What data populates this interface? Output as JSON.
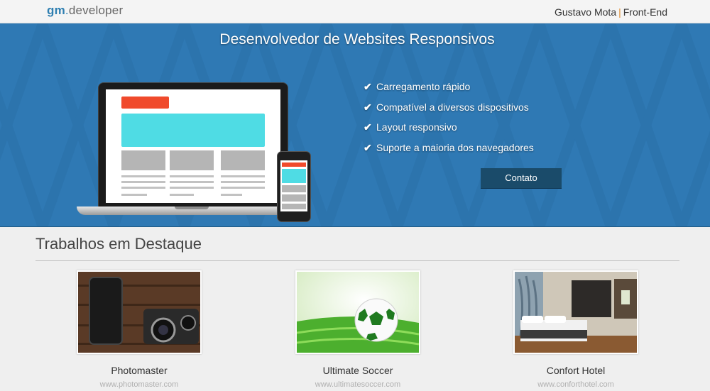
{
  "header": {
    "logo_prefix": "gm",
    "logo_dot": ".",
    "logo_suffix": "developer",
    "author_name": "Gustavo Mota",
    "author_separator": "|",
    "author_role": "Front-End"
  },
  "hero": {
    "title": "Desenvolvedor de Websites Responsivos",
    "features": [
      {
        "icon": "check-icon",
        "label": "Carregamento rápido"
      },
      {
        "icon": "check-icon",
        "label": "Compatível a diversos dispositivos"
      },
      {
        "icon": "check-icon",
        "label": "Layout responsivo"
      },
      {
        "icon": "check-icon",
        "label": "Suporte a maioria dos navegadores"
      }
    ],
    "contact_label": "Contato"
  },
  "works": {
    "title": "Trabalhos em Destaque",
    "items": [
      {
        "title": "Photomaster",
        "url": "www.photomaster.com"
      },
      {
        "title": "Ultimate Soccer",
        "url": "www.ultimatesoccer.com"
      },
      {
        "title": "Confort Hotel",
        "url": "www.conforthotel.com"
      }
    ]
  },
  "colors": {
    "hero_blue": "#2f79b4",
    "button": "#1a4b6a",
    "accent_separator": "#e08a2a",
    "mock_red": "#f04a2c",
    "mock_cyan": "#4fdce4"
  }
}
